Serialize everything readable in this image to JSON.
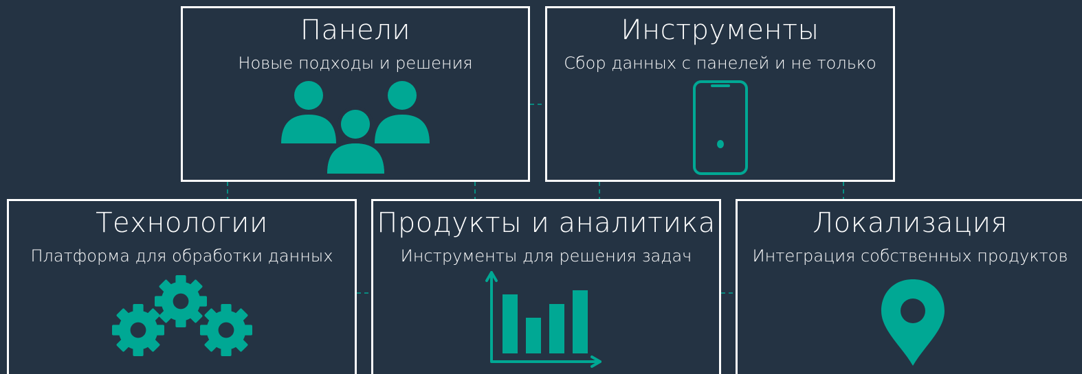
{
  "colors": {
    "background": "#243343",
    "border": "#ffffff",
    "accent": "#00a894",
    "text": "#ffffff"
  },
  "cards": {
    "panels": {
      "title": "Панели",
      "subtitle": "Новые подходы и решения",
      "icon": "people-group-icon"
    },
    "tools": {
      "title": "Инструменты",
      "subtitle": "Сбор данных с панелей и не только",
      "icon": "smartphone-icon"
    },
    "tech": {
      "title": "Технологии",
      "subtitle": "Платформа для обработки данных",
      "icon": "gears-icon"
    },
    "products": {
      "title": "Продукты и аналитика",
      "subtitle": "Инструменты для решения задач",
      "icon": "bar-chart-icon"
    },
    "local": {
      "title": "Локализация",
      "subtitle": "Интеграция собственных продуктов",
      "icon": "map-pin-icon"
    }
  }
}
